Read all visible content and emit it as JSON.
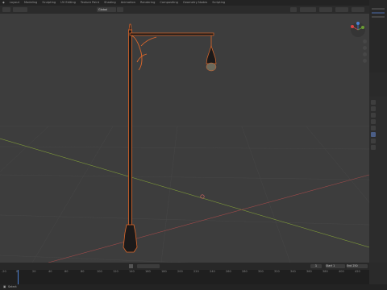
{
  "workspace_tabs": [
    "Layout",
    "Modeling",
    "Sculpting",
    "UV Editing",
    "Texture Paint",
    "Shading",
    "Animation",
    "Rendering",
    "Compositing",
    "Geometry Nodes",
    "Scripting"
  ],
  "active_tab_index": 0,
  "header": {
    "view_label": "Global"
  },
  "gizmo": {
    "x": "X",
    "y": "Y",
    "z": "Z"
  },
  "timeline": {
    "ticks": [
      "-20",
      "0",
      "20",
      "40",
      "60",
      "80",
      "100",
      "120",
      "140",
      "160",
      "180",
      "200",
      "220",
      "240",
      "260",
      "280",
      "300",
      "320",
      "340",
      "360",
      "380",
      "400",
      "420"
    ],
    "start_label": "Start",
    "start": "1",
    "end_label": "End",
    "end": "250",
    "current_frame": "1"
  },
  "status": {
    "left_label": "Select"
  },
  "colors": {
    "viewport_bg": "#3d3d3d",
    "selection_outline": "#e0682a",
    "x_axis": "#a04a4a",
    "y_axis": "#7f9a3a"
  }
}
